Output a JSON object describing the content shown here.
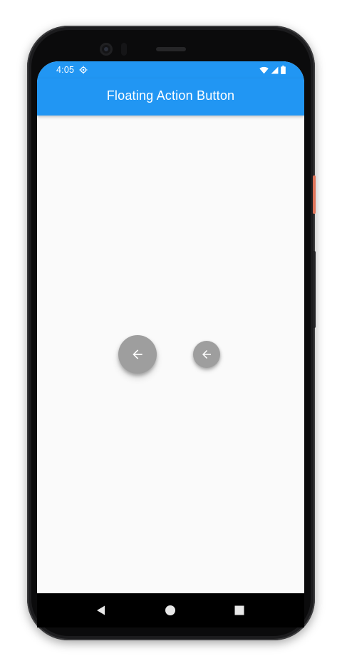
{
  "status_bar": {
    "time": "4:05",
    "settings_icon": "settings-gear-icon",
    "wifi_icon": "wifi-icon",
    "signal_icon": "cell-signal-icon",
    "battery_icon": "battery-icon"
  },
  "app_bar": {
    "title": "Floating Action Button"
  },
  "body": {
    "fab_large": {
      "icon": "arrow-back-icon"
    },
    "fab_small": {
      "icon": "arrow-back-icon"
    }
  },
  "navigation_bar": {
    "back_icon": "nav-back-icon",
    "home_icon": "nav-home-icon",
    "recents_icon": "nav-recents-icon"
  },
  "colors": {
    "primary": "#2196f3",
    "fab": "#9e9e9e",
    "background": "#fafafa",
    "nav_bar": "#000000"
  }
}
